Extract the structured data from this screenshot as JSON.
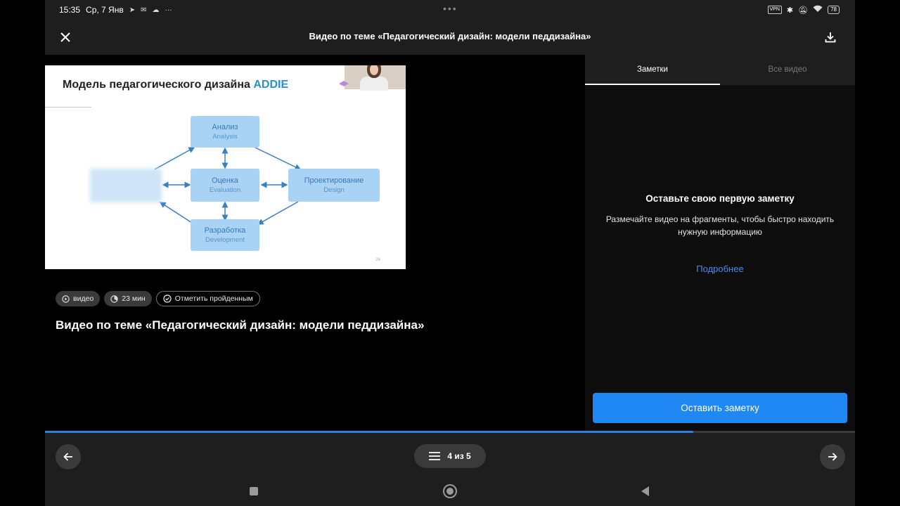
{
  "status_bar": {
    "time": "15:35",
    "date": "Ср, 7 Янв",
    "vpn": "VPN",
    "battery": "78"
  },
  "header": {
    "title": "Видео по теме «Педагогический дизайн: модели педдизайна»"
  },
  "video": {
    "slide_title_main": "Модель педагогического дизайна",
    "slide_title_accent": "ADDIE",
    "boxes": {
      "analysis": {
        "ru": "Анализ",
        "en": "Analysis"
      },
      "evaluation": {
        "ru": "Оценка",
        "en": "Evaluation"
      },
      "design": {
        "ru": "Проектирование",
        "en": "Design"
      },
      "development": {
        "ru": "Разработка",
        "en": "Development"
      }
    },
    "slide_number": "26"
  },
  "chips": {
    "type": "видео",
    "duration": "23 мин",
    "mark_done": "Отметить пройденным"
  },
  "main": {
    "heading": "Видео по теме «Педагогический дизайн: модели педдизайна»"
  },
  "panel": {
    "tabs": [
      "Заметки",
      "Все видео"
    ],
    "active_tab": 0,
    "empty_title": "Оставьте свою первую заметку",
    "empty_text": "Размечайте видео на фрагменты, чтобы быстро находить нужную информацию",
    "more_link": "Подробнее",
    "add_note_button": "Оставить заметку"
  },
  "progress": {
    "fraction": 0.8,
    "color": "#2a82e0"
  },
  "pager": {
    "label": "4 из 5"
  },
  "colors": {
    "accent": "#1f88f3",
    "link": "#3d8ef5",
    "slide_accent": "#2c8ecf"
  }
}
